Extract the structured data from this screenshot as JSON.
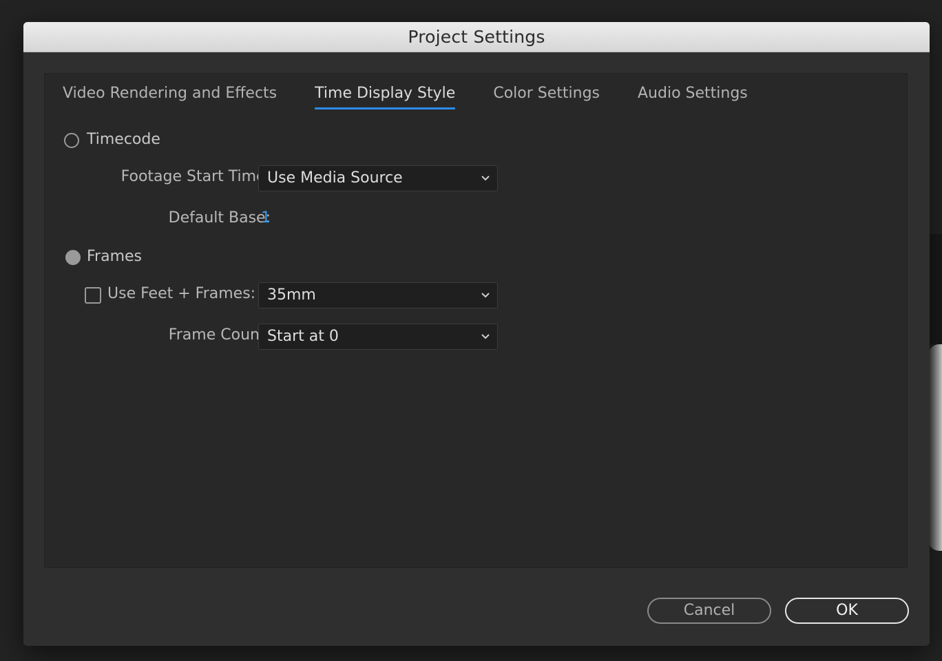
{
  "window": {
    "title": "Project Settings"
  },
  "tabs": [
    {
      "label": "Video Rendering and Effects",
      "active": false
    },
    {
      "label": "Time Display Style",
      "active": true
    },
    {
      "label": "Color Settings",
      "active": false
    },
    {
      "label": "Audio Settings",
      "active": false
    }
  ],
  "timecode": {
    "radio_label": "Timecode",
    "selected": false,
    "footage_start_label": "Footage Start Time:",
    "footage_start_value": "Use Media Source",
    "default_base_label": "Default Base:",
    "default_base_value": "1"
  },
  "frames": {
    "radio_label": "Frames",
    "selected": true,
    "feet_frames_label": "Use Feet + Frames:",
    "feet_frames_checked": false,
    "feet_frames_value": "35mm",
    "frame_count_label": "Frame Count:",
    "frame_count_value": "Start at 0"
  },
  "buttons": {
    "cancel": "Cancel",
    "ok": "OK"
  },
  "colors": {
    "accent": "#2d8ceb",
    "link": "#3a9cf2",
    "dialog_bg": "#2f2f2f",
    "panel_bg": "#282828"
  }
}
